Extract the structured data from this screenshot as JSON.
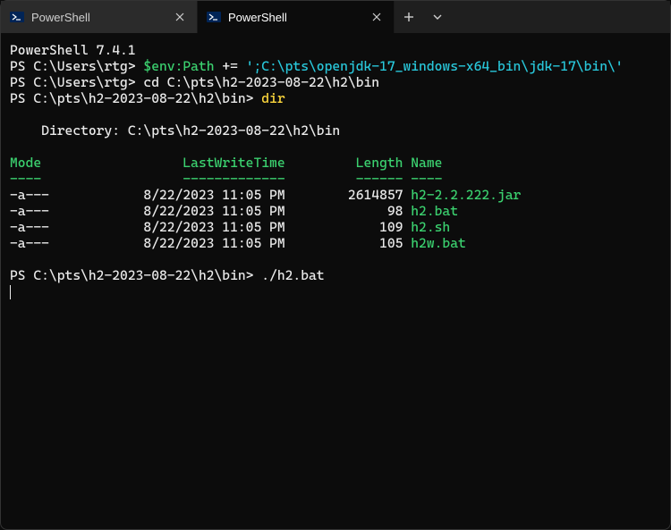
{
  "tabs": [
    {
      "title": "PowerShell",
      "active": false
    },
    {
      "title": "PowerShell",
      "active": true
    }
  ],
  "version_line": "PowerShell 7.4.1",
  "prompt1": "PS C:\\Users\\rtg> ",
  "cmd1_part1": "$env:Path",
  "cmd1_part2": " += ",
  "cmd1_part3": "';C:\\pts\\openjdk-17_windows-x64_bin\\jdk-17\\bin\\'",
  "prompt2": "PS C:\\Users\\rtg> ",
  "cmd2": "cd C:\\pts\\h2-2023-08-22\\h2\\bin",
  "prompt3": "PS C:\\pts\\h2-2023-08-22\\h2\\bin> ",
  "cmd3": "dir",
  "blank": "",
  "directory_label": "    Directory: C:\\pts\\h2-2023-08-22\\h2\\bin",
  "headers": {
    "mode": "Mode",
    "lastwrite": "LastWriteTime",
    "length": "Length",
    "name": "Name"
  },
  "underlines": {
    "mode": "----",
    "lastwrite": "-------------",
    "length": "------",
    "name": "----"
  },
  "rows": [
    {
      "mode": "-a---",
      "date": "8/22/2023",
      "time": "11:05 PM",
      "length": "2614857",
      "name": "h2-2.2.222.jar"
    },
    {
      "mode": "-a---",
      "date": "8/22/2023",
      "time": "11:05 PM",
      "length": "98",
      "name": "h2.bat"
    },
    {
      "mode": "-a---",
      "date": "8/22/2023",
      "time": "11:05 PM",
      "length": "109",
      "name": "h2.sh"
    },
    {
      "mode": "-a---",
      "date": "8/22/2023",
      "time": "11:05 PM",
      "length": "105",
      "name": "h2w.bat"
    }
  ],
  "prompt4": "PS C:\\pts\\h2-2023-08-22\\h2\\bin> ",
  "cmd4": "./h2.bat"
}
